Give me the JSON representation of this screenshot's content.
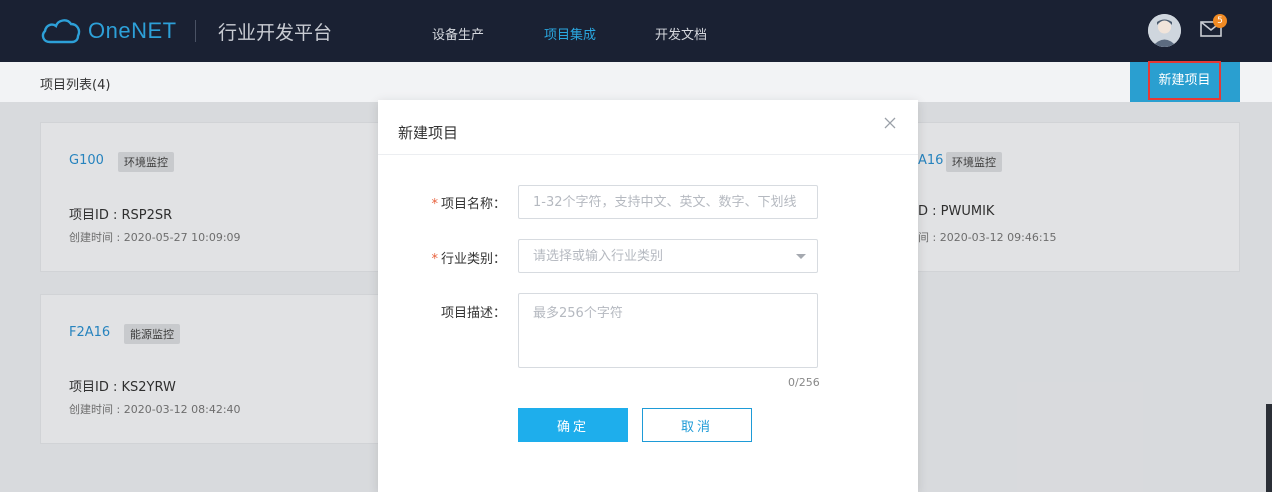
{
  "brand": {
    "logo_text": "OneNET",
    "platform_title": "行业开发平台",
    "accent": "#2aa8e0"
  },
  "nav": {
    "items": [
      {
        "label": "设备生产",
        "active": false
      },
      {
        "label": "项目集成",
        "active": true
      },
      {
        "label": "开发文档",
        "active": false
      }
    ],
    "mail_badge": "5"
  },
  "subheader": {
    "title": "项目列表(4)",
    "new_project_label": "新建项目"
  },
  "projects": [
    {
      "name": "G100",
      "tag": "环境监控",
      "id_line": "项目ID : RSP2SR",
      "time_line": "创建时间 : 2020-05-27 10:09:09"
    },
    {
      "name": "F2A16",
      "tag": "能源监控",
      "id_line": "项目ID : KS2YRW",
      "time_line": "创建时间 : 2020-03-12 08:42:40"
    },
    {
      "name": "A16",
      "tag": "环境监控",
      "id_line": "D : PWUMIK",
      "time_line": "间 : 2020-03-12 09:46:15"
    }
  ],
  "modal": {
    "title": "新建项目",
    "fields": {
      "name": {
        "label": "项目名称：",
        "required_mark": "*",
        "placeholder": "1-32个字符，支持中文、英文、数字、下划线"
      },
      "category": {
        "label": "行业类别：",
        "required_mark": "*",
        "placeholder": "请选择或输入行业类别"
      },
      "description": {
        "label": "项目描述：",
        "placeholder": "最多256个字符",
        "counter": "0/256"
      }
    },
    "confirm_label": "确定",
    "cancel_label": "取消"
  }
}
